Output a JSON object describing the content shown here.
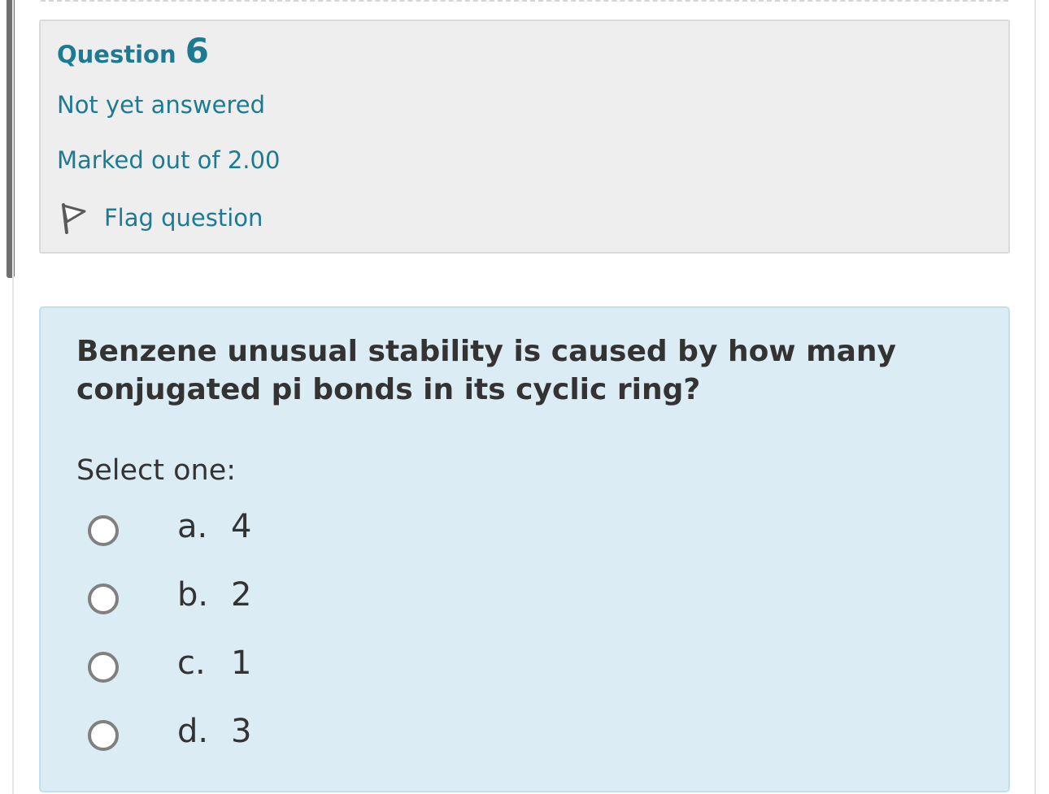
{
  "question_info": {
    "title_word": "Question",
    "number": "6",
    "state": "Not yet answered",
    "grade": "Marked out of 2.00",
    "flag_label": "Flag question"
  },
  "formulation": {
    "question_text": "Benzene unusual stability is caused by how many conjugated pi bonds in its cyclic ring?",
    "prompt": "Select one:",
    "answers": [
      {
        "letter": "a.",
        "value": "4",
        "selected": false
      },
      {
        "letter": "b.",
        "value": "2",
        "selected": false
      },
      {
        "letter": "c.",
        "value": "1",
        "selected": false
      },
      {
        "letter": "d.",
        "value": "3",
        "selected": false
      }
    ]
  },
  "colors": {
    "link_text": "#1d7a93",
    "info_background": "#eeeeee",
    "content_background": "#dcecf5",
    "body_text": "#333333"
  },
  "icons": {
    "flag": "flag-icon",
    "radio": "radio-unchecked-icon"
  }
}
